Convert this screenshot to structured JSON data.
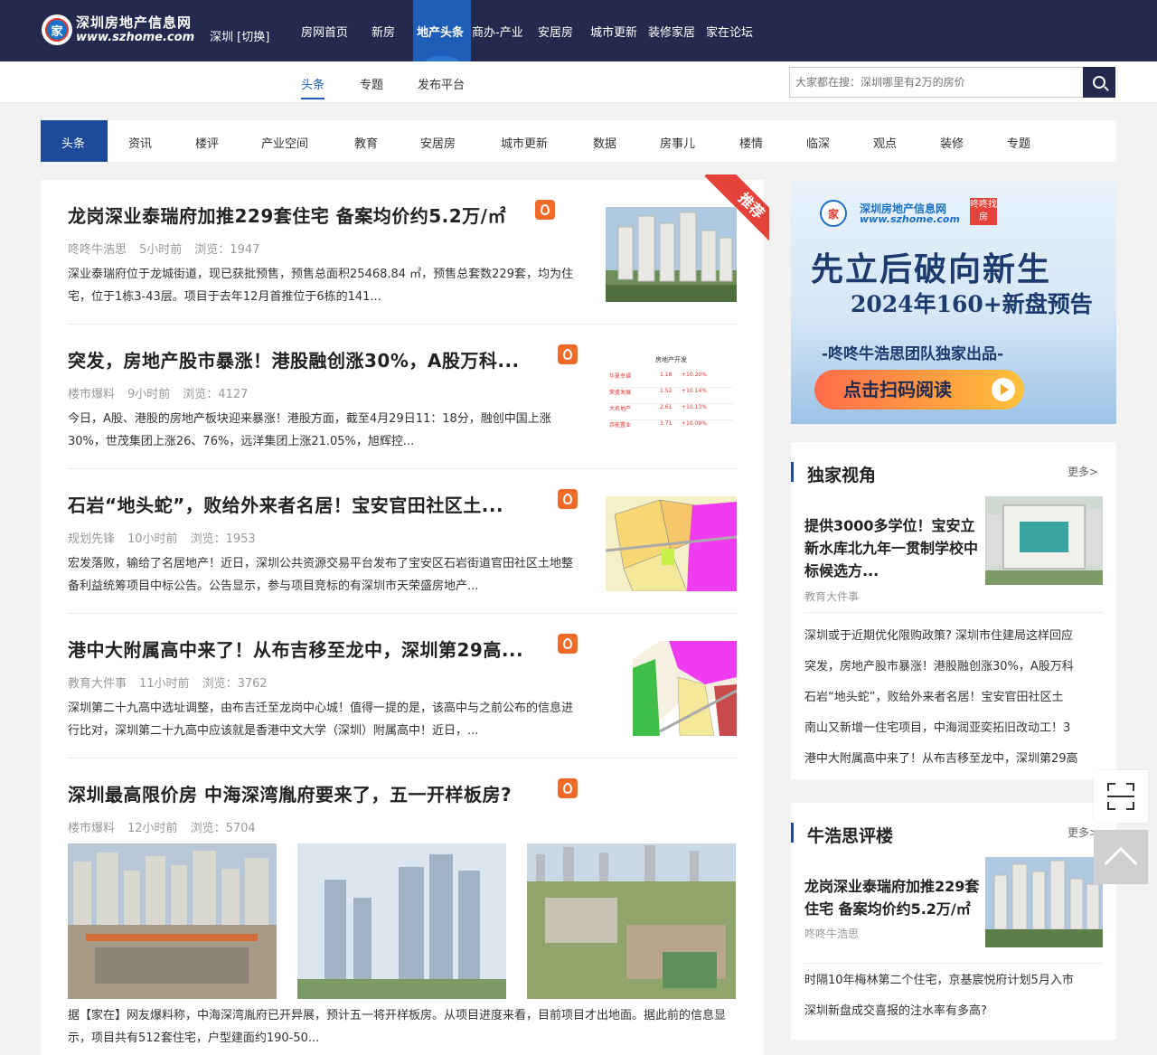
{
  "site": {
    "name": "深圳房地产信息网",
    "url": "www.szhome.com",
    "logo_char": "家",
    "city": "深圳 [切换]"
  },
  "nav": [
    "房网首页",
    "新房",
    "地产头条",
    "商办-产业",
    "安居房",
    "城市更新",
    "装修家居",
    "家在论坛"
  ],
  "nav_active": "地产头条",
  "subnav": [
    "头条",
    "专题",
    "发布平台"
  ],
  "search": {
    "placeholder": "大家都在搜：深圳哪里有2万的房价"
  },
  "categories": [
    "头条",
    "资讯",
    "楼评",
    "产业空间",
    "教育",
    "安居房",
    "城市更新",
    "数据",
    "房事儿",
    "楼情",
    "临深",
    "观点",
    "装修",
    "专题"
  ],
  "ribbon": "推荐",
  "articles": [
    {
      "title": "龙岗深业泰瑞府加推229套住宅 备案均价约5.2万/㎡",
      "source": "咚咚牛浩思",
      "time": "5小时前",
      "views": "浏览：1947",
      "desc": "深业泰瑞府位于龙城街道，现已获批预售，预售总面积25468.84 ㎡，预售总套数229套，均为住宅，位于1栋3-43层。项目于去年12月首推位于6栋的141..."
    },
    {
      "title": "突发，房地产股市暴涨！港股融创涨30%，A股万科...",
      "source": "楼市爆料",
      "time": "9小时前",
      "views": "浏览：4127",
      "desc": "今日，A股、港股的房地产板块迎来暴涨！港股方面，截至4月29日11：18分，融创中国上涨30%，世茂集团上涨26、76%，远洋集团上涨21.05%，旭辉控..."
    },
    {
      "title": "石岩“地头蛇”，败给外来者名居！宝安官田社区土...",
      "source": "规划先锋",
      "time": "10小时前",
      "views": "浏览：1953",
      "desc": "宏发落败，输给了名居地产！近日，深圳公共资源交易平台发布了宝安区石岩街道官田社区土地整备利益统筹项目中标公告。公告显示，参与项目竞标的有深圳市天荣盛房地产..."
    },
    {
      "title": "港中大附属高中来了！从布吉移至龙中，深圳第29高...",
      "source": "教育大件事",
      "time": "11小时前",
      "views": "浏览：3762",
      "desc": "深圳第二十九高中选址调整，由布吉迁至龙岗中心城！值得一提的是，该高中与之前公布的信息进行比对，深圳第二十九高中应该就是香港中文大学（深圳）附属高中！近日，..."
    },
    {
      "title": "深圳最高限价房 中海深湾胤府要来了，五一开样板房?",
      "source": "楼市爆料",
      "time": "12小时前",
      "views": "浏览：5704",
      "desc": "据【家在】网友爆料称，中海深湾胤府已开异展，预计五一将开样板房。从项目进度来看，目前项目才出地面。据此前的信息显示，项目共有512套住宅，户型建面约190-50..."
    }
  ],
  "stock_thumb": {
    "header": "房地产开发",
    "rows": [
      [
        "华夏幸福",
        "1.18",
        "+10.20%"
      ],
      [
        "荣盛发展",
        "1.52",
        "+10.14%"
      ],
      [
        "大名地产",
        "2.61",
        "+10.13%"
      ],
      [
        "京能置业",
        "3.71",
        "+10.09%"
      ]
    ]
  },
  "banner": {
    "brand": "深圳房地产信息网",
    "url": "www.szhome.com",
    "tag": "咚咚找房",
    "headline": "先立后破向新生",
    "subhead": "2024年160+新盘预告",
    "byline": "-咚咚牛浩思团队独家出品-",
    "button": "点击扫码阅读"
  },
  "panel1": {
    "title": "独家视角",
    "more": "更多>",
    "feature": {
      "title": "提供3000多学位！宝安立新水库北九年一贯制学校中标候选方...",
      "source": "教育大件事"
    },
    "items": [
      "深圳或于近期优化限购政策? 深圳市住建局这样回应",
      "突发，房地产股市暴涨！港股融创涨30%，A股万科",
      "石岩“地头蛇”，败给外来者名居！宝安官田社区土",
      "南山又新增一住宅项目，中海润亚奕拓旧改动工！3",
      "港中大附属高中来了！从布吉移至龙中，深圳第29高"
    ]
  },
  "panel2": {
    "title": "牛浩思评楼",
    "more": "更多>",
    "feature": {
      "title": "龙岗深业泰瑞府加推229套住宅 备案均价约5.2万/㎡",
      "source": "咚咚牛浩思"
    },
    "items": [
      "时隔10年梅林第二个住宅，京基宸悦府计划5月入市",
      "深圳新盘成交喜报的注水率有多高?"
    ]
  },
  "colors": {
    "topbar": "#232a4e",
    "accent": "#1e4a9c",
    "hot": "#f06a2a",
    "ribbon": "#e5423a"
  }
}
